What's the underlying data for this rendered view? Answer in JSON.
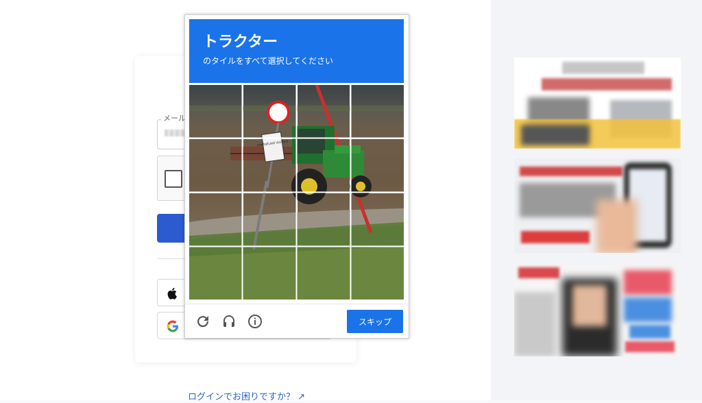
{
  "login": {
    "email_label": "メール",
    "help_link": "ログインでお困りですか？ ↗"
  },
  "captcha": {
    "title": "トラクター",
    "subtitle": "のタイルをすべて選択してください",
    "skip_label": "スキップ",
    "grid": {
      "rows": 4,
      "cols": 4
    },
    "sign_text": "ZEMĚDĚLSKÉ VOZIDLO"
  },
  "colors": {
    "captcha_blue": "#1a73e8",
    "login_button": "#2b5bce",
    "link": "#2a62c9"
  },
  "icons": {
    "reload": "reload-icon",
    "audio": "headphones-icon",
    "info": "info-icon",
    "apple": "apple-icon",
    "google": "google-icon"
  }
}
